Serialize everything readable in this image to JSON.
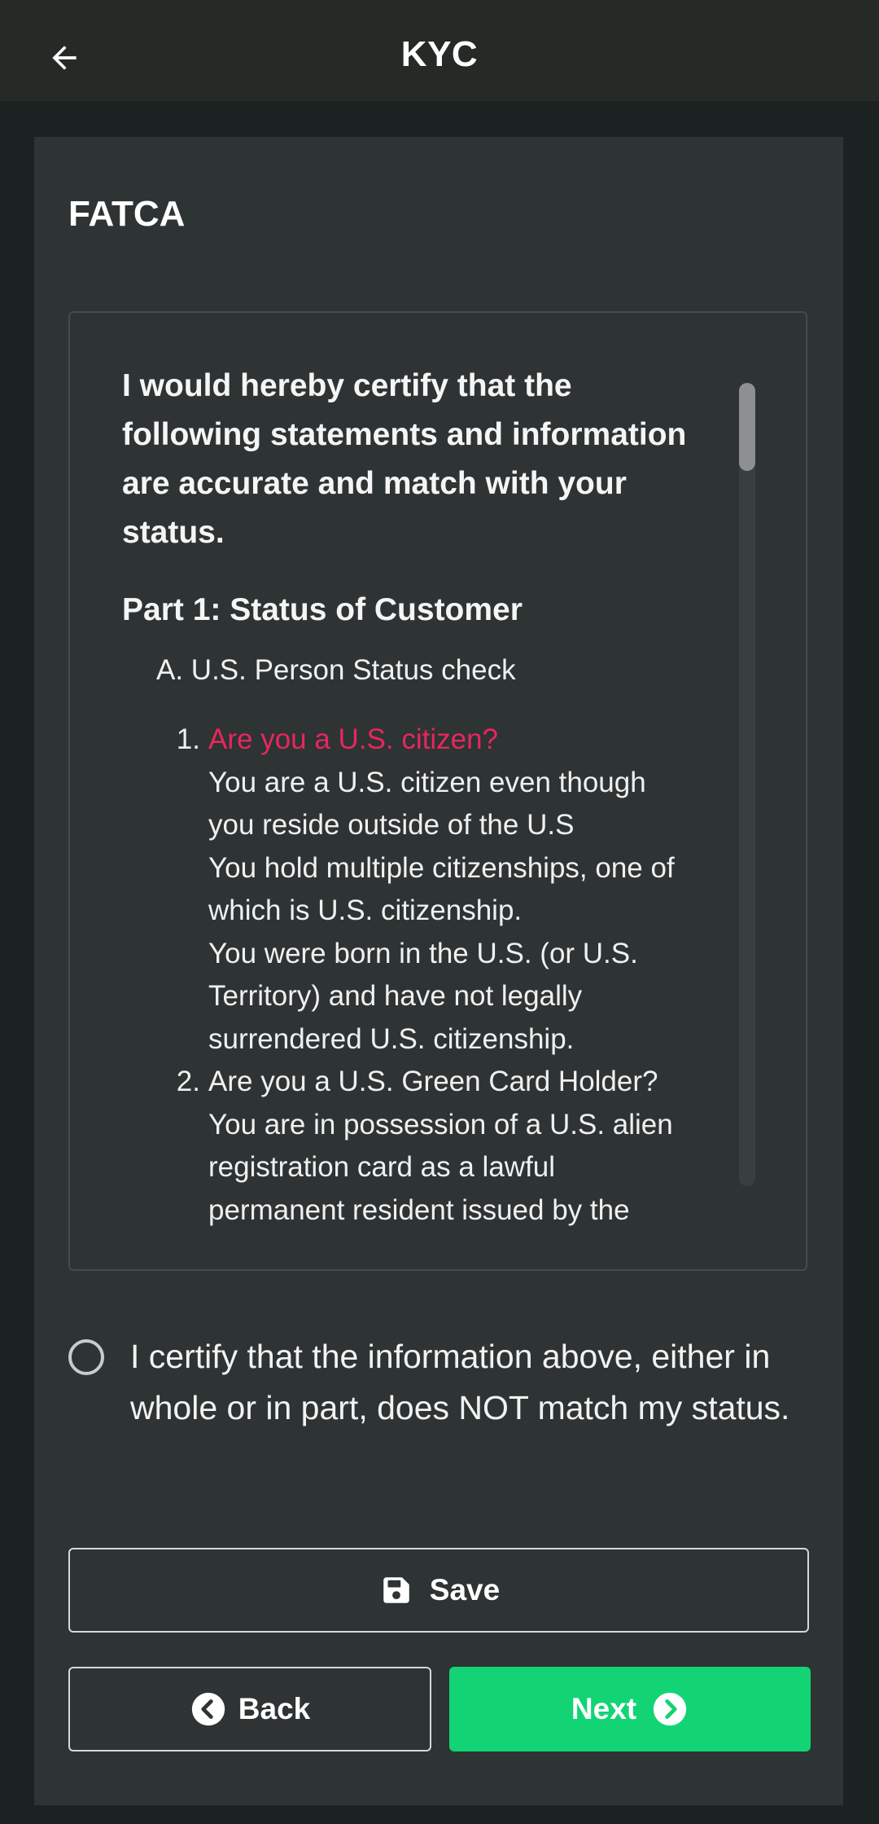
{
  "header": {
    "title": "KYC",
    "back_icon": "arrow-left-icon"
  },
  "card": {
    "title": "FATCA",
    "terms": {
      "intro": "I would hereby certify that the following statements and information are accurate and match with your status.",
      "part_heading": "Part 1: Status of Customer",
      "section_heading": "A. U.S. Person Status check",
      "questions": [
        {
          "number": "1.",
          "title": "Are you a U.S. citizen?",
          "details": [
            "You are a U.S. citizen even though you reside outside of the U.S",
            "You hold multiple citizenships, one of which is U.S. citizenship.",
            "You were born in the U.S. (or U.S. Territory) and have not legally surrendered U.S. citizenship."
          ]
        },
        {
          "number": "2.",
          "title": "Are you a U.S. Green Card Holder?",
          "details": [
            "You are in possession of a U.S. alien registration card as a lawful permanent resident issued by the"
          ]
        }
      ]
    },
    "certify_label": "I certify that the information above, either in whole or in part, does NOT match my status.",
    "certify_checked": false
  },
  "buttons": {
    "save_label": "Save",
    "back_label": "Back",
    "next_label": "Next"
  },
  "colors": {
    "accent_green": "#12d474",
    "question_highlight": "#e8265d",
    "card_bg": "#2e3333",
    "page_bg": "#1c2122"
  }
}
